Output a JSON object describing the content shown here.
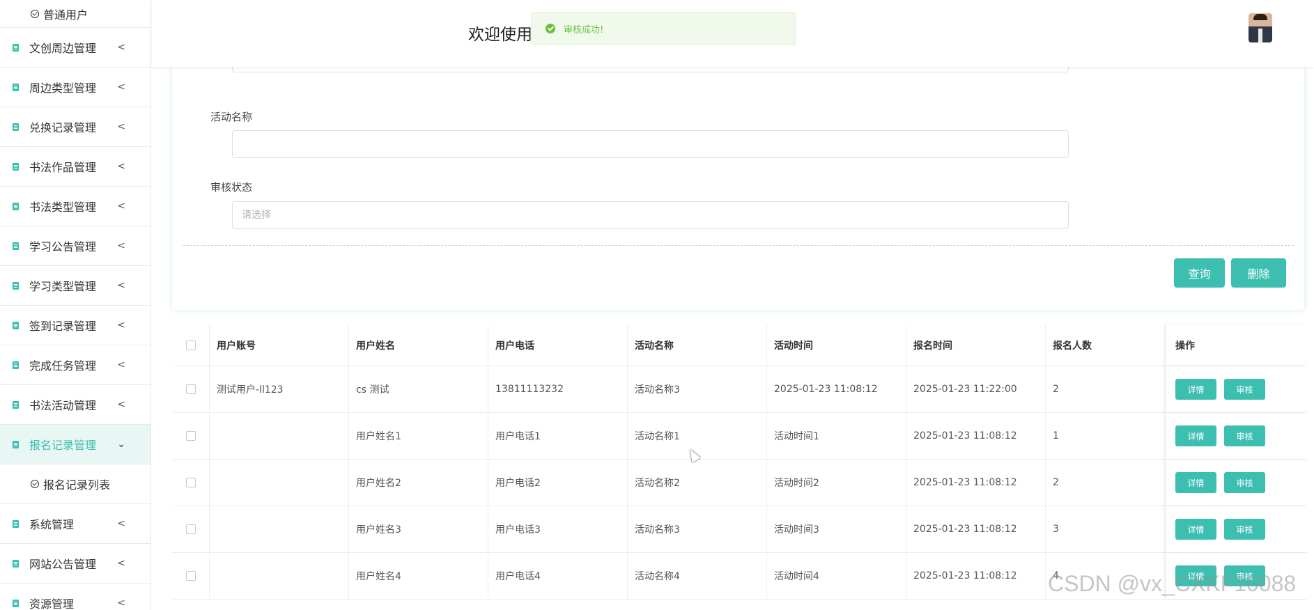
{
  "sidebar": {
    "top_sub": "普通用户",
    "items": [
      {
        "label": "文创周边管理",
        "chevron": "<"
      },
      {
        "label": "周边类型管理",
        "chevron": "<"
      },
      {
        "label": "兑换记录管理",
        "chevron": "<"
      },
      {
        "label": "书法作品管理",
        "chevron": "<"
      },
      {
        "label": "书法类型管理",
        "chevron": "<"
      },
      {
        "label": "学习公告管理",
        "chevron": "<"
      },
      {
        "label": "学习类型管理",
        "chevron": "<"
      },
      {
        "label": "签到记录管理",
        "chevron": "<"
      },
      {
        "label": "完成任务管理",
        "chevron": "<"
      },
      {
        "label": "书法活动管理",
        "chevron": "<"
      },
      {
        "label": "报名记录管理",
        "chevron": "⌄"
      },
      {
        "label": "系统管理",
        "chevron": "<"
      },
      {
        "label": "网站公告管理",
        "chevron": "<"
      },
      {
        "label": "资源管理",
        "chevron": "<"
      }
    ],
    "active_sub": "报名记录列表"
  },
  "header": {
    "title": "欢迎使用"
  },
  "toast": {
    "message": "审核成功!",
    "color": "#67c23a"
  },
  "search": {
    "activity_label": "活动名称",
    "status_label": "审核状态",
    "status_placeholder": "请选择",
    "query_button": "查询",
    "delete_button": "删除"
  },
  "table": {
    "headers": [
      "用户账号",
      "用户姓名",
      "用户电话",
      "活动名称",
      "活动时间",
      "报名时间",
      "报名人数",
      "操作"
    ],
    "rows": [
      [
        "测试用户-ll123",
        "cs 测试",
        "13811113232",
        "活动名称3",
        "2025-01-23 11:08:12",
        "2025-01-23 11:22:00",
        "2"
      ],
      [
        "",
        "用户姓名1",
        "用户电话1",
        "活动名称1",
        "活动时间1",
        "2025-01-23 11:08:12",
        "1"
      ],
      [
        "",
        "用户姓名2",
        "用户电话2",
        "活动名称2",
        "活动时间2",
        "2025-01-23 11:08:12",
        "2"
      ],
      [
        "",
        "用户姓名3",
        "用户电话3",
        "活动名称3",
        "活动时间3",
        "2025-01-23 11:08:12",
        "3"
      ],
      [
        "",
        "用户姓名4",
        "用户电话4",
        "活动名称4",
        "活动时间4",
        "2025-01-23 11:08:12",
        "4"
      ]
    ],
    "detail_button": "详情",
    "audit_button": "审核"
  },
  "watermark": "CSDN @vx_CXKF10088",
  "colors": {
    "accent": "#3cbfb1",
    "active_bg": "#e8f6f4"
  }
}
